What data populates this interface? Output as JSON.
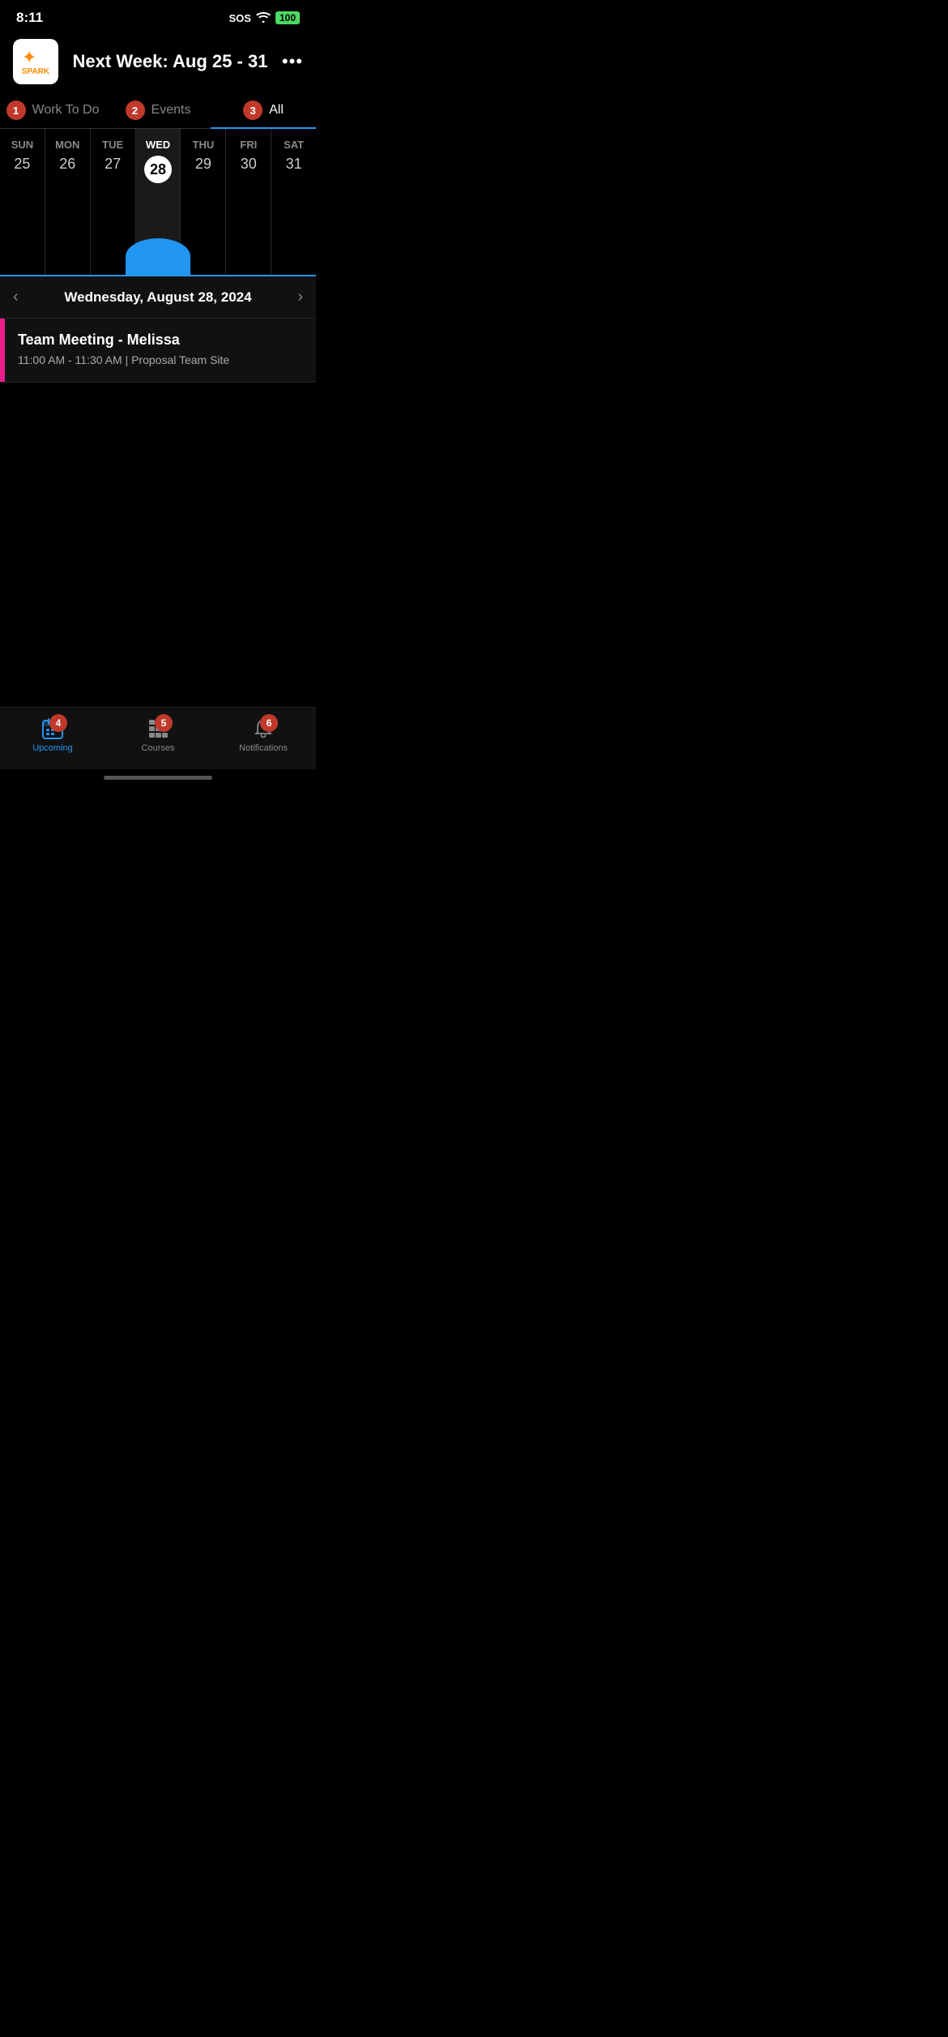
{
  "statusBar": {
    "time": "8:11",
    "sos": "SOS",
    "battery": "100"
  },
  "header": {
    "title": "Next Week: Aug 25 - 31",
    "moreLabel": "•••",
    "logoText": "SPARK"
  },
  "tabs": [
    {
      "id": "work",
      "label": "Work To Do",
      "badge": "1",
      "active": false
    },
    {
      "id": "events",
      "label": "Events",
      "badge": "2",
      "active": false
    },
    {
      "id": "all",
      "label": "All",
      "badge": "3",
      "active": true
    }
  ],
  "calendar": {
    "days": [
      {
        "name": "SUN",
        "num": "25",
        "today": false
      },
      {
        "name": "MON",
        "num": "26",
        "today": false
      },
      {
        "name": "TUE",
        "num": "27",
        "today": false
      },
      {
        "name": "WED",
        "num": "28",
        "today": true
      },
      {
        "name": "THU",
        "num": "29",
        "today": false
      },
      {
        "name": "FRI",
        "num": "30",
        "today": false
      },
      {
        "name": "SAT",
        "num": "31",
        "today": false
      }
    ]
  },
  "dateNav": {
    "currentDate": "Wednesday, August 28, 2024",
    "prevArrow": "‹",
    "nextArrow": "›"
  },
  "event": {
    "title": "Team Meeting - Melissa",
    "time": "11:00 AM - 11:30 AM | Proposal Team Site"
  },
  "bottomNav": {
    "items": [
      {
        "id": "upcoming",
        "label": "Upcoming",
        "badge": "4",
        "active": true
      },
      {
        "id": "courses",
        "label": "Courses",
        "badge": "5",
        "active": false
      },
      {
        "id": "notifications",
        "label": "Notifications",
        "badge": "6",
        "active": false
      }
    ]
  },
  "colors": {
    "accent": "#2196f3",
    "eventAccent": "#e91e8c",
    "badgeBg": "#c0392b",
    "activeNav": "#2196f3"
  }
}
